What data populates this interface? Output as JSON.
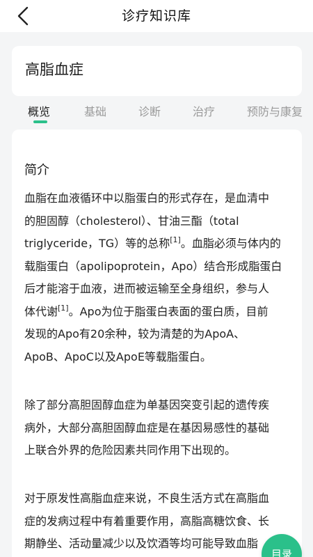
{
  "header": {
    "title": "诊疗知识库",
    "back_icon": "chevron-left-icon"
  },
  "topic": {
    "title": "高脂血症"
  },
  "tabs": [
    {
      "label": "概览",
      "active": true
    },
    {
      "label": "基础",
      "active": false
    },
    {
      "label": "诊断",
      "active": false
    },
    {
      "label": "治疗",
      "active": false
    },
    {
      "label": "预防与康复",
      "active": false
    }
  ],
  "content": {
    "section_title": "简介",
    "p1": {
      "l1": "血脂在血液循环中以脂蛋白的形式存在，是血清中",
      "l2": "的胆固醇（cholesterol）、甘油三酯（total",
      "l3a": "triglyceride，TG）等的总称",
      "l3sup": "[1]",
      "l3b": "。血脂必须与体内的",
      "l4": "载脂蛋白（apolipoprotein，Apo）结合形成脂蛋白",
      "l5": "后才能溶于血液，进而被运输至全身组织，参与人",
      "l6a": "体代谢",
      "l6sup": "[1]",
      "l6b": "。Apo为位于脂蛋白表面的蛋白质，目前",
      "l7": "发现的Apo有20余种，较为清楚的为ApoA、",
      "l8": "ApoB、ApoC以及ApoE等载脂蛋白。"
    },
    "p2": {
      "l1": "除了部分高胆固醇血症为单基因突变引起的遗传疾",
      "l2": "病外，大部分高胆固醇血症是在基因易感性的基础",
      "l3": "上联合外界的危险因素共同作用下出现的。"
    },
    "p3": {
      "l1": "对于原发性高脂血症来说，不良生活方式在高脂血",
      "l2": "症的发病过程中有着重要作用，高脂高糖饮食、长",
      "l3": "期静坐、活动量减少以及饮酒等均可能导致血脂"
    }
  },
  "toc": {
    "label": "目录"
  },
  "colors": {
    "accent": "#2bc08a"
  }
}
